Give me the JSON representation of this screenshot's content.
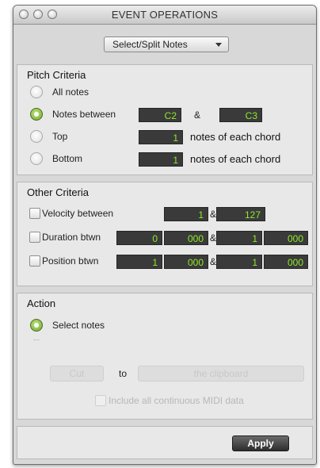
{
  "window": {
    "title": "EVENT OPERATIONS"
  },
  "operation_menu": {
    "selected": "Select/Split Notes"
  },
  "pitch_criteria": {
    "heading": "Pitch Criteria",
    "all_notes_label": "All notes",
    "notes_between_label": "Notes between",
    "notes_between_from": "C2",
    "notes_between_amp": "&",
    "notes_between_to": "C3",
    "top_label": "Top",
    "top_value": "1",
    "top_suffix": "notes of each chord",
    "bottom_label": "Bottom",
    "bottom_value": "1",
    "bottom_suffix": "notes of each chord",
    "selected_option": "Notes between"
  },
  "other_criteria": {
    "heading": "Other Criteria",
    "velocity_label": "Velocity between",
    "velocity_min": "1",
    "velocity_amp": "&",
    "velocity_max": "127",
    "duration_label": "Duration btwn",
    "duration_min_a": "0",
    "duration_min_b": "000",
    "duration_amp": "&",
    "duration_max_a": "1",
    "duration_max_b": "000",
    "position_label": "Position btwn",
    "position_min_a": "1",
    "position_min_b": "000",
    "position_amp": "&",
    "position_max_a": "1",
    "position_max_b": "000"
  },
  "action": {
    "heading": "Action",
    "select_notes_label": "Select notes",
    "cut_label": "Cut",
    "to_label": "to",
    "clipboard_label": "the clipboard",
    "include_midi_label": "Include all continuous MIDI data"
  },
  "footer": {
    "apply_label": "Apply"
  },
  "colors": {
    "field_text": "#8fea2a",
    "field_bg": "#3a3a3a",
    "radio_on": "#6da52a"
  }
}
